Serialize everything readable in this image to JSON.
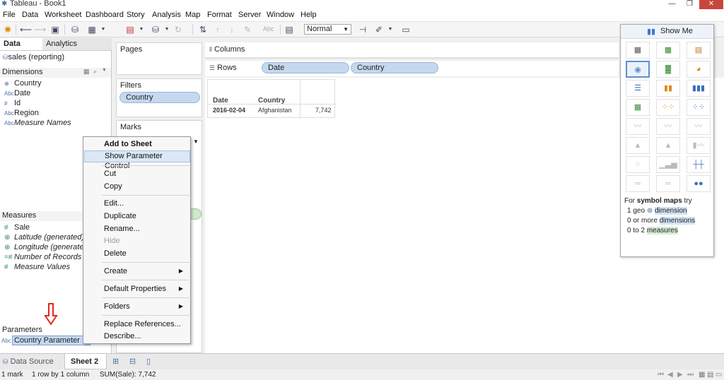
{
  "window": {
    "title": "Tableau - Book1"
  },
  "menu": [
    "File",
    "Data",
    "Worksheet",
    "Dashboard",
    "Story",
    "Analysis",
    "Map",
    "Format",
    "Server",
    "Window",
    "Help"
  ],
  "toolbar": {
    "fit": "Normal",
    "abc": "Abc"
  },
  "datapane": {
    "tabs": [
      "Data",
      "Analytics"
    ],
    "datasource": "sales (reporting)",
    "dimensions_header": "Dimensions",
    "dimensions": [
      {
        "icon": "globe-icon",
        "label": "Country",
        "italic": false
      },
      {
        "icon": "abc-icon",
        "label": "Date",
        "italic": false
      },
      {
        "icon": "number-icon",
        "label": "Id",
        "italic": false
      },
      {
        "icon": "abc-icon",
        "label": "Region",
        "italic": false
      },
      {
        "icon": "abc-icon",
        "label": "Measure Names",
        "italic": true
      }
    ],
    "measures_header": "Measures",
    "measures": [
      {
        "icon": "number-icon",
        "label": "Sale",
        "italic": false
      },
      {
        "icon": "globe-icon",
        "label": "Latitude (generated)",
        "italic": true
      },
      {
        "icon": "globe-icon",
        "label": "Longitude (generated)",
        "italic": true
      },
      {
        "icon": "number-icon",
        "label": "Number of Records",
        "italic": true
      },
      {
        "icon": "number-icon",
        "label": "Measure Values",
        "italic": true
      }
    ],
    "parameters_header": "Parameters",
    "parameter": {
      "icon": "abc-icon",
      "label": "Country Parameter"
    }
  },
  "cards": {
    "pages": "Pages",
    "filters": "Filters",
    "filter_pill": "Country",
    "marks": "Marks"
  },
  "shelves": {
    "columns_label": "Columns",
    "rows_label": "Rows",
    "rows_pills": [
      "Date",
      "Country"
    ]
  },
  "viz": {
    "headers": [
      "Date",
      "Country"
    ],
    "row": {
      "date": "2016-02-04",
      "country": "Afghanistan",
      "value": "7,742"
    }
  },
  "context_menu": [
    {
      "label": "Add to Sheet",
      "style": "bold"
    },
    {
      "label": "Show Parameter Control",
      "style": "highlight"
    },
    {
      "label": "Cut"
    },
    {
      "label": "Copy"
    },
    {
      "label": "Edit..."
    },
    {
      "label": "Duplicate"
    },
    {
      "label": "Rename..."
    },
    {
      "label": "Hide",
      "style": "disabled"
    },
    {
      "label": "Delete"
    },
    {
      "label": "Create",
      "submenu": true
    },
    {
      "label": "Default Properties",
      "submenu": true
    },
    {
      "label": "Folders",
      "submenu": true
    },
    {
      "label": "Replace References..."
    },
    {
      "label": "Describe..."
    }
  ],
  "showme": {
    "title": "Show Me",
    "hint_prefix": "For",
    "hint_bold": "symbol maps",
    "hint_suffix": "try",
    "req1_a": "1 geo",
    "req1_b": "dimension",
    "req2_a": "0 or more",
    "req2_b": "dimensions",
    "req3_a": "0 to 2",
    "req3_b": "measures"
  },
  "sheetbar": {
    "datasource_tab": "Data Source",
    "sheet_tab": "Sheet 2"
  },
  "status": {
    "marks": "1 mark",
    "dims": "1 row by 1 column",
    "sum": "SUM(Sale): 7,742"
  },
  "colors": {
    "pill_blue": "#c5d8ef",
    "pill_green": "#cfe9cc",
    "arrow_red": "#e0281e",
    "selection": "#dbe7f6"
  }
}
